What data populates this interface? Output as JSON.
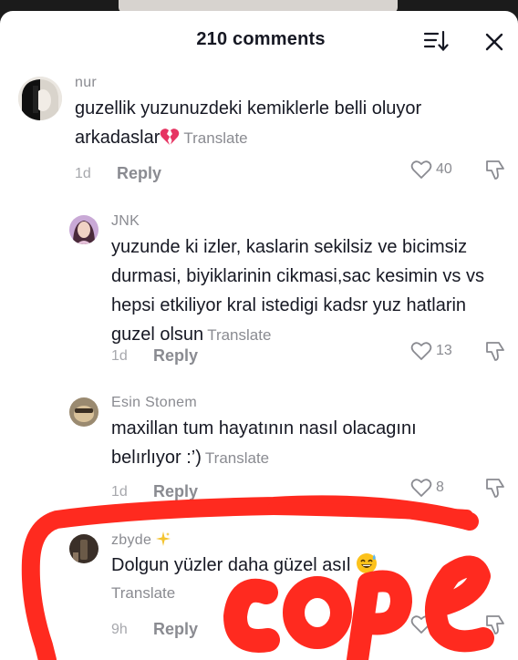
{
  "header": {
    "title": "210 comments",
    "sort_icon": "sort-icon",
    "close_icon": "close-icon"
  },
  "comments": [
    {
      "username": "nur",
      "text": "guzellik yuzunuzdeki kemiklerle belli oluyor arkadaslar",
      "emoji": "broken-heart-emoji",
      "translate": "Translate",
      "time": "1d",
      "reply": "Reply",
      "likes": "40"
    },
    {
      "username": "JNK",
      "text": "yuzunde ki izler, kaslarin sekilsiz ve bicimsiz durmasi, biyiklarinin cikmasi,sac kesimin vs vs hepsi etkiliyor kral istedigi kadsr yuz hatlarin guzel olsun",
      "translate": "Translate",
      "time": "1d",
      "reply": "Reply",
      "likes": "13"
    },
    {
      "username": "Esin Stonem",
      "text": "maxillan tum hayatının nasıl olacagını belırlıyor :’)",
      "translate": "Translate",
      "time": "1d",
      "reply": "Reply",
      "likes": "8"
    },
    {
      "username": "zbyde",
      "text": "Dolgun yüzler daha güzel asıl",
      "emoji": "sweat-smile-emoji",
      "translate": "Translate",
      "time": "9h",
      "reply": "Reply"
    }
  ],
  "annotation": {
    "scribble_text": "cope",
    "color": "#ff2a1f"
  },
  "colors": {
    "text": "#161823",
    "muted": "#8a8b91",
    "background": "#ffffff"
  }
}
